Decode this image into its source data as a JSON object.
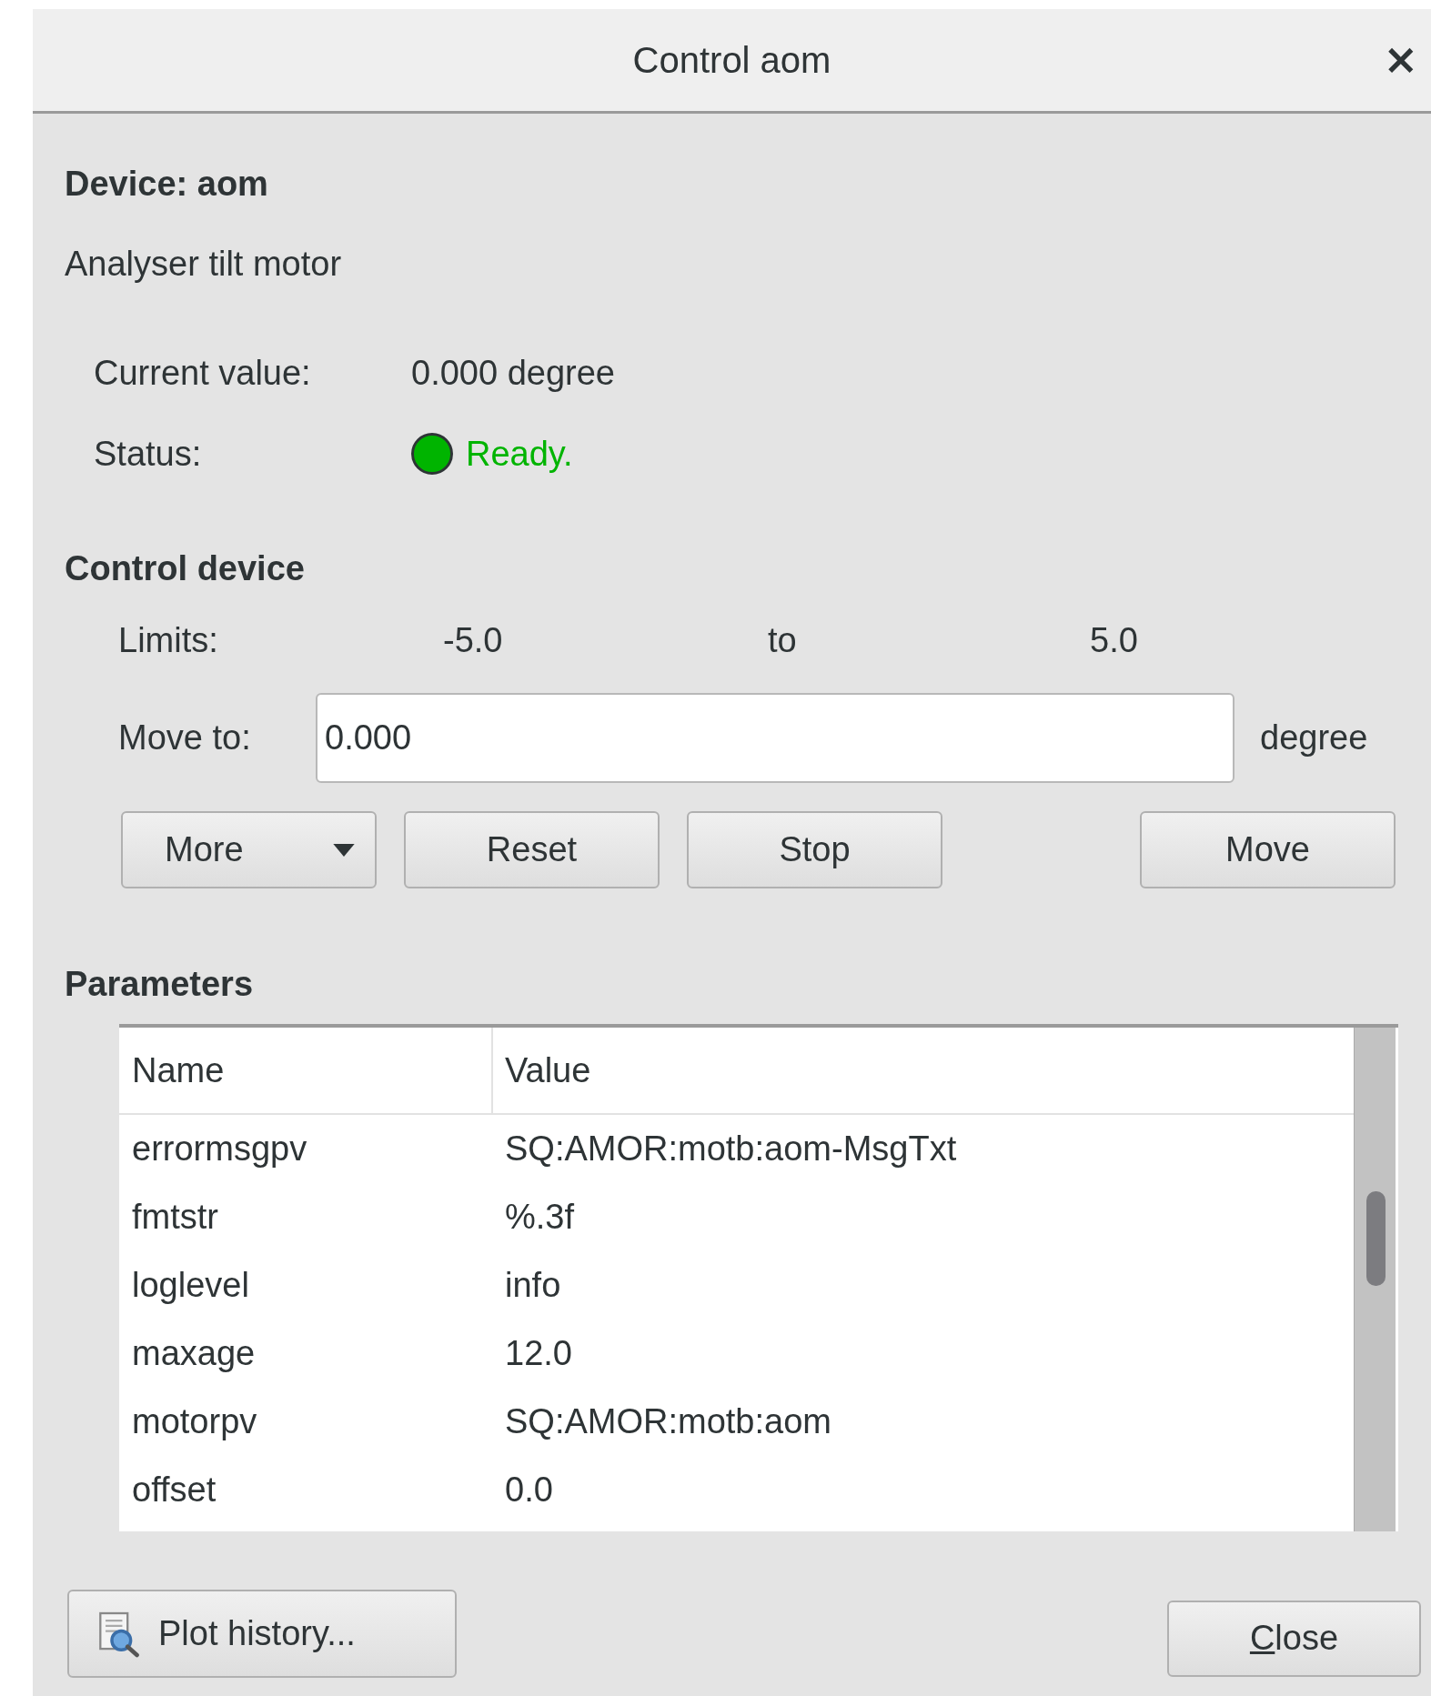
{
  "window": {
    "title": "Control aom",
    "close": "×"
  },
  "device": {
    "heading": "Device: aom",
    "description": "Analyser tilt motor"
  },
  "info": [
    {
      "label": "Current value:",
      "value": "0.000 degree"
    },
    {
      "label": "Status:",
      "value": "Ready.",
      "color": "#00b400"
    }
  ],
  "control": {
    "heading": "Control device",
    "limits_label": "Limits:",
    "min": "-5.0",
    "to": "to",
    "max": "5.0",
    "move_label": "Move to:",
    "move_value": "0.000",
    "unit": "degree",
    "left_buttons": [
      {
        "label": "More",
        "kind": "dropdown"
      },
      {
        "label": "Reset",
        "kind": "plain"
      },
      {
        "label": "Stop",
        "kind": "plain"
      }
    ],
    "right_buttons": [
      {
        "label": "Move",
        "kind": "plain"
      }
    ]
  },
  "parameters": {
    "heading": "Parameters",
    "columns": [
      "Name",
      "Value"
    ],
    "rows": [
      [
        "errormsgpv",
        "SQ:AMOR:motb:aom-MsgTxt"
      ],
      [
        "fmtstr",
        "%.3f"
      ],
      [
        "loglevel",
        "info"
      ],
      [
        "maxage",
        "12.0"
      ],
      [
        "motorpv",
        "SQ:AMOR:motb:aom"
      ],
      [
        "offset",
        "0.0"
      ]
    ]
  },
  "footer": {
    "plot_button": "Plot history...",
    "close_button": "Close",
    "close_mnemonic": true
  }
}
